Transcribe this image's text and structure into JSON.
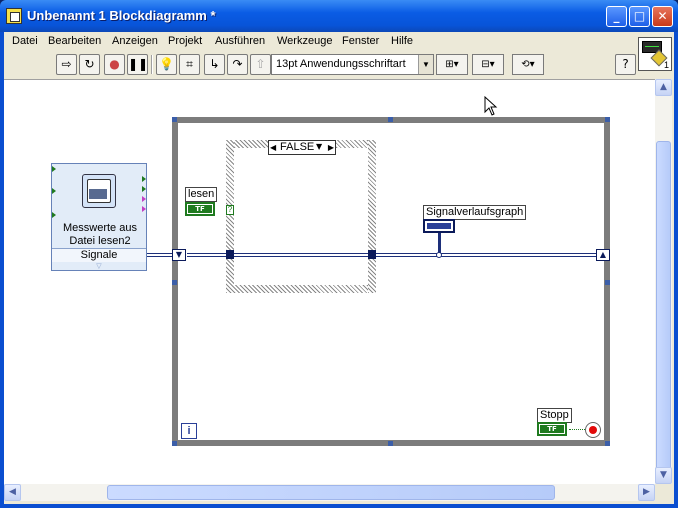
{
  "window": {
    "title": "Unbenannt 1 Blockdiagramm *"
  },
  "menu": [
    {
      "label": "Datei"
    },
    {
      "label": "Bearbeiten"
    },
    {
      "label": "Anzeigen"
    },
    {
      "label": "Projekt"
    },
    {
      "label": "Ausführen"
    },
    {
      "label": "Werkzeuge"
    },
    {
      "label": "Fenster"
    },
    {
      "label": "Hilfe"
    }
  ],
  "toolbar": {
    "font_select": "13pt Anwendungsschriftart",
    "help": "?",
    "vi_icon_number": "1"
  },
  "diagram": {
    "subvi": {
      "title": "Messwerte aus Datei lesen2",
      "output_label": "Signale"
    },
    "case_selector": "FALSE",
    "read_control_label": "lesen",
    "graph_label": "Signalverlaufsgraph",
    "stop_label": "Stopp",
    "tf_text": "TF",
    "iteration_text": "i",
    "question_mark": "?"
  },
  "colors": {
    "titlebar": "#0a5ce5",
    "wire_dynamic": "#1d2f7a",
    "boolean": "#1f7a1f",
    "stop": "#e20a0a",
    "loop_frame": "#7c7c7c"
  }
}
